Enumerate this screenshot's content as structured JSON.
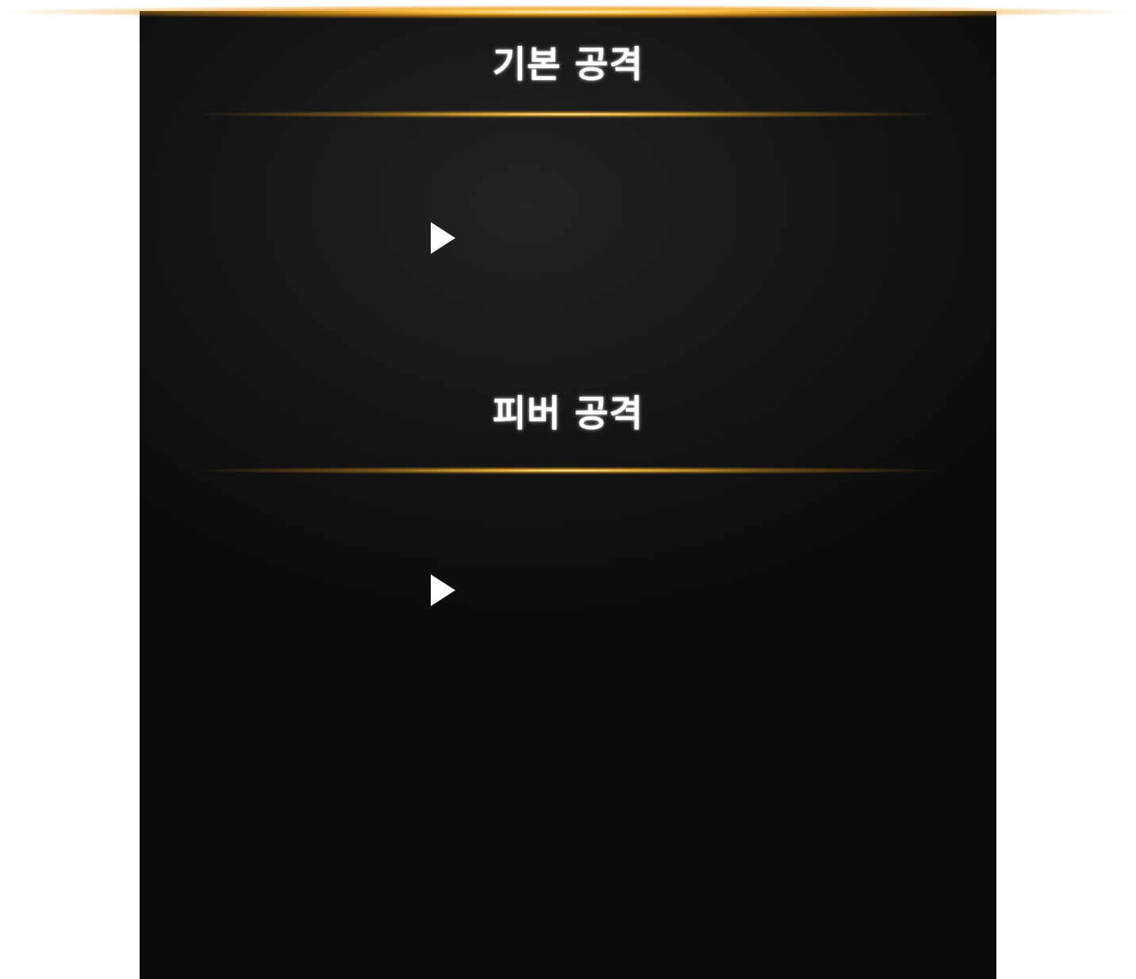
{
  "sections": [
    {
      "title": "기본 공격",
      "play_icon": "play-icon"
    },
    {
      "title": "피버 공격",
      "play_icon": "play-icon"
    }
  ],
  "colors": {
    "accent_glow": "#f5a623",
    "panel_bg": "#141414",
    "title_text": "#ffffff"
  }
}
